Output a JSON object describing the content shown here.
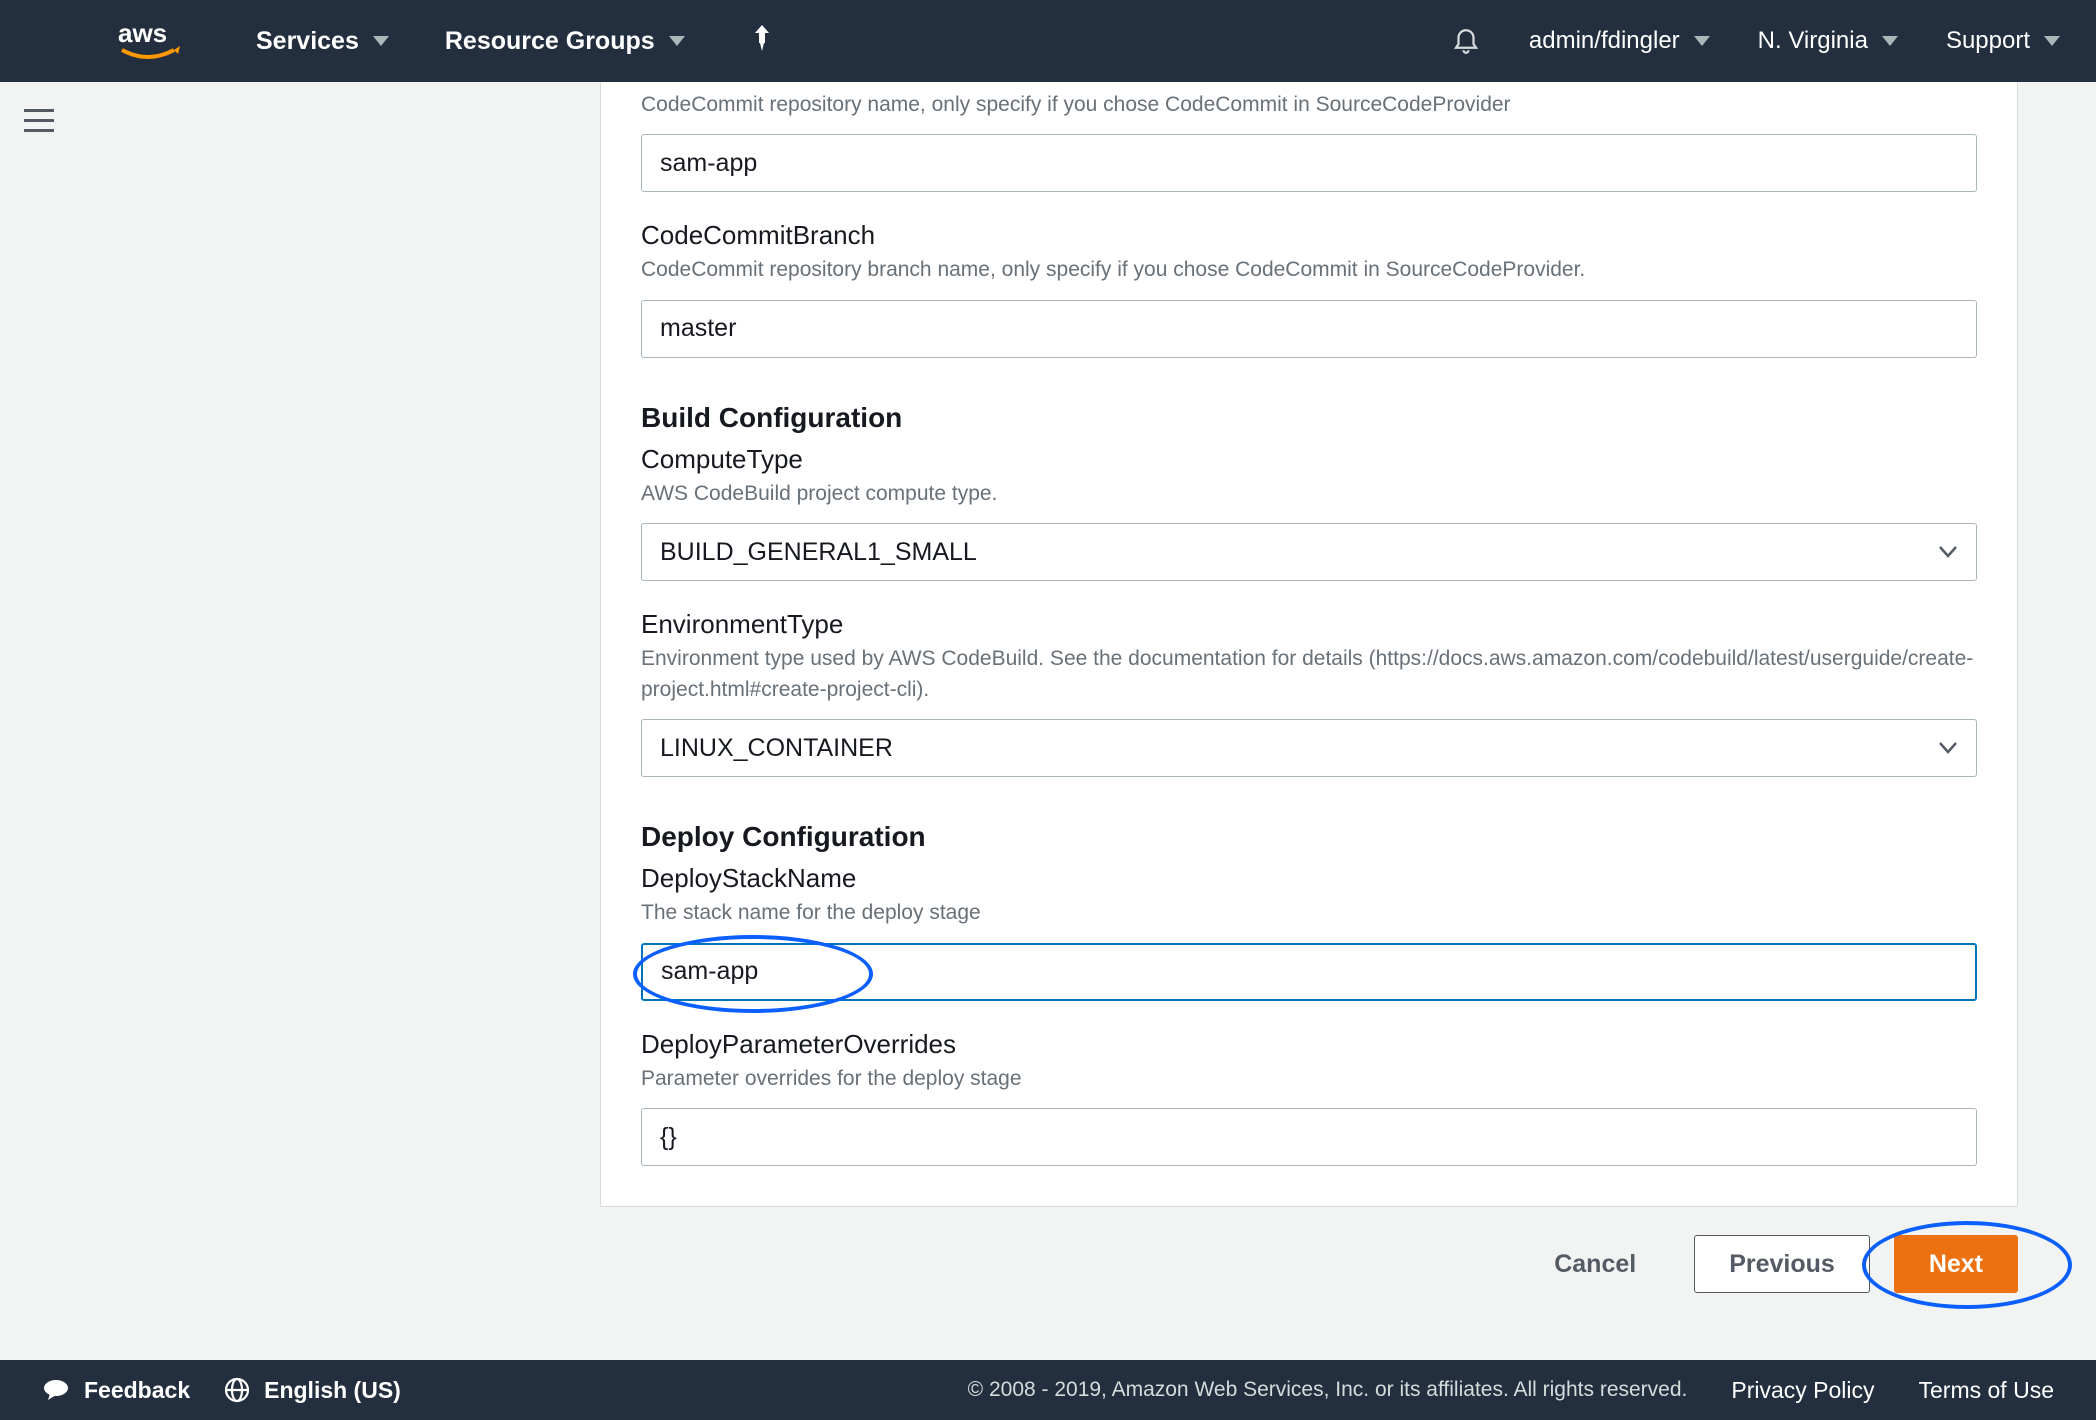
{
  "header": {
    "services_label": "Services",
    "resource_groups_label": "Resource Groups",
    "account_label": "admin/fdingler",
    "region_label": "N. Virginia",
    "support_label": "Support"
  },
  "form": {
    "codecommit_repo": {
      "desc": "CodeCommit repository name, only specify if you chose CodeCommit in SourceCodeProvider",
      "value": "sam-app"
    },
    "codecommit_branch": {
      "label": "CodeCommitBranch",
      "desc": "CodeCommit repository branch name, only specify if you chose CodeCommit in SourceCodeProvider.",
      "value": "master"
    },
    "build_heading": "Build Configuration",
    "compute_type": {
      "label": "ComputeType",
      "desc": "AWS CodeBuild project compute type.",
      "value": "BUILD_GENERAL1_SMALL"
    },
    "environment_type": {
      "label": "EnvironmentType",
      "desc": "Environment type used by AWS CodeBuild. See the documentation for details (https://docs.aws.amazon.com/codebuild/latest/userguide/create-project.html#create-project-cli).",
      "value": "LINUX_CONTAINER"
    },
    "deploy_heading": "Deploy Configuration",
    "deploy_stack": {
      "label": "DeployStackName",
      "desc": "The stack name for the deploy stage",
      "value": "sam-app"
    },
    "deploy_overrides": {
      "label": "DeployParameterOverrides",
      "desc": "Parameter overrides for the deploy stage",
      "value": "{}"
    }
  },
  "buttons": {
    "cancel": "Cancel",
    "previous": "Previous",
    "next": "Next"
  },
  "footer": {
    "feedback": "Feedback",
    "language": "English (US)",
    "copyright": "© 2008 - 2019, Amazon Web Services, Inc. or its affiliates. All rights reserved.",
    "privacy": "Privacy Policy",
    "terms": "Terms of Use"
  }
}
